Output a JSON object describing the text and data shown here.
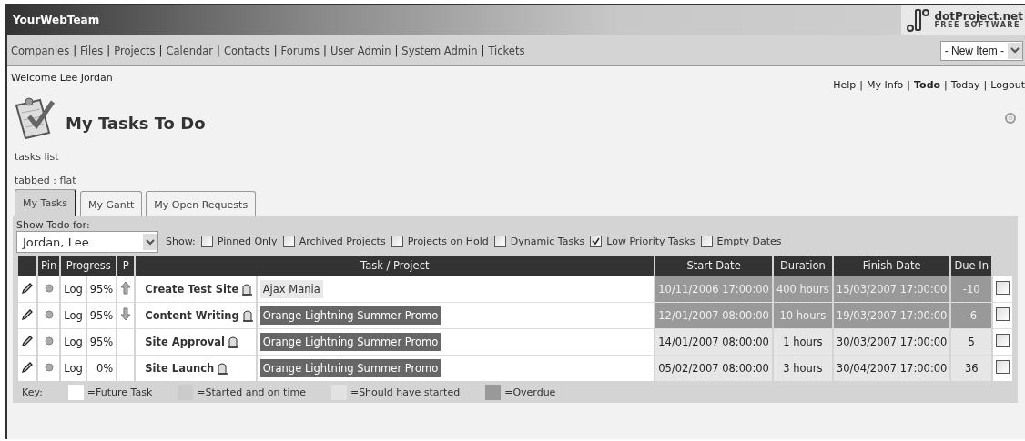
{
  "header": {
    "team": "YourWebTeam",
    "logo_name": "dotProject.net",
    "logo_tagline": "FREE SOFTWARE"
  },
  "nav": {
    "separator": "|",
    "links": [
      "Companies",
      "Files",
      "Projects",
      "Calendar",
      "Contacts",
      "Forums",
      "User Admin",
      "System Admin",
      "Tickets"
    ],
    "new_item": "- New Item -"
  },
  "welcome": "Welcome Lee Jordan",
  "user_links_separator": "|",
  "user_links": [
    {
      "label": "Help",
      "selected": false
    },
    {
      "label": "My Info",
      "selected": false
    },
    {
      "label": "Todo",
      "selected": true
    },
    {
      "label": "Today",
      "selected": false
    },
    {
      "label": "Logout",
      "selected": false
    }
  ],
  "page_title": "My Tasks To Do",
  "notes": [
    "tasks list",
    "tabbed : flat"
  ],
  "tabs": [
    {
      "label": "My Tasks",
      "selected": true
    },
    {
      "label": "My Gantt",
      "selected": false
    },
    {
      "label": "My Open Requests",
      "selected": false
    }
  ],
  "filter": {
    "label": "Show Todo for:",
    "user": "Jordan, Lee",
    "show_label": "Show:",
    "options": [
      {
        "label": "Pinned Only",
        "checked": false
      },
      {
        "label": "Archived Projects",
        "checked": false
      },
      {
        "label": "Projects on Hold",
        "checked": false
      },
      {
        "label": "Dynamic Tasks",
        "checked": false
      },
      {
        "label": "Low Priority Tasks",
        "checked": true
      },
      {
        "label": "Empty Dates",
        "checked": false
      }
    ]
  },
  "table": {
    "columns": [
      "Pin",
      "Progress",
      "P",
      "Task / Project",
      "Start Date",
      "Duration",
      "Finish Date",
      "Due In"
    ],
    "rows": [
      {
        "log": "Log",
        "progress": "95%",
        "high_priority": true,
        "low_priority": false,
        "task": "Create Test Site",
        "project": "Ajax Mania",
        "color": "#e8e8e8",
        "start": "10/11/2006 17:00:00",
        "duration": "400 hours",
        "finish": "15/03/2007 17:00:00",
        "due_in": "-10",
        "kind": "overdue",
        "checked": false
      },
      {
        "log": "Log",
        "progress": "95%",
        "high_priority": false,
        "low_priority": true,
        "task": "Content Writing",
        "project": "Orange Lightning Summer Promo",
        "color": "#666666",
        "start": "12/01/2007 08:00:00",
        "duration": "10 hours",
        "finish": "19/03/2007 17:00:00",
        "due_in": "-6",
        "kind": "overdue",
        "checked": false
      },
      {
        "log": "Log",
        "progress": "95%",
        "high_priority": false,
        "low_priority": false,
        "task": "Site Approval",
        "project": "Orange Lightning Summer Promo",
        "color": "#666666",
        "start": "14/01/2007 08:00:00",
        "duration": "1 hours",
        "finish": "30/03/2007 17:00:00",
        "due_in": "5",
        "kind": "started",
        "checked": false
      },
      {
        "log": "Log",
        "progress": "0%",
        "high_priority": false,
        "low_priority": false,
        "task": "Site Launch",
        "project": "Orange Lightning Summer Promo",
        "color": "#666666",
        "start": "05/02/2007 08:00:00",
        "duration": "3 hours",
        "finish": "30/04/2007 17:00:00",
        "due_in": "36",
        "kind": "started",
        "checked": false
      }
    ]
  },
  "key": {
    "label": "Key:",
    "items": [
      {
        "label": "=Future Task",
        "color": "#ffffff"
      },
      {
        "label": "=Started and on time",
        "color": "#cbcbcb"
      },
      {
        "label": "=Should have started",
        "color": "#e2e2e2"
      },
      {
        "label": "=Overdue",
        "color": "#999999"
      }
    ]
  }
}
